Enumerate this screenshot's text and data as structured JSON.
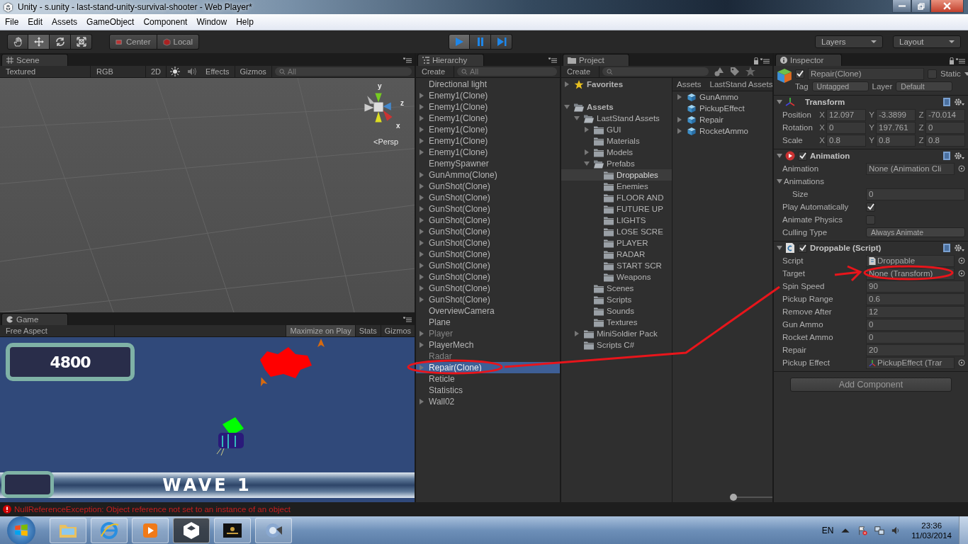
{
  "window": {
    "title": "Unity - s.unity - last-stand-unity-survival-shooter - Web Player*"
  },
  "menu": [
    "File",
    "Edit",
    "Assets",
    "GameObject",
    "Component",
    "Window",
    "Help"
  ],
  "toolbar": {
    "tools": [
      {
        "kind": "hand",
        "selected": false
      },
      {
        "kind": "move",
        "selected": true
      },
      {
        "kind": "rotate",
        "selected": false
      },
      {
        "kind": "scale",
        "selected": false
      }
    ],
    "pivot": [
      {
        "kind": "pivot",
        "label": "Center"
      },
      {
        "kind": "local",
        "label": "Local"
      }
    ],
    "playback": [
      {
        "kind": "play",
        "selected": true
      },
      {
        "kind": "pause",
        "selected": false
      },
      {
        "kind": "step",
        "selected": false
      }
    ],
    "layers": "Layers",
    "layout": "Layout"
  },
  "scene": {
    "tab": "Scene",
    "shading": "Textured",
    "render": "RGB",
    "mode_2d": "2D",
    "effects": "Effects",
    "gizmos": "Gizmos",
    "search_placeholder": "All",
    "axes": [
      "y",
      "z",
      "x"
    ],
    "projection": "<Persp"
  },
  "game": {
    "tab": "Game",
    "aspect": "Free Aspect",
    "buttons": [
      {
        "label": "Maximize on Play",
        "selected": true
      },
      {
        "label": "Stats",
        "selected": false
      },
      {
        "label": "Gizmos",
        "selected": false
      }
    ],
    "score": "4800",
    "wave": "WAVE 1"
  },
  "hierarchy": {
    "tab": "Hierarchy",
    "create": "Create",
    "search_placeholder": "All",
    "items": [
      {
        "label": "Directional light",
        "expandable": false,
        "disabled": false,
        "selected": false
      },
      {
        "label": "Enemy1(Clone)",
        "expandable": true,
        "disabled": false,
        "selected": false
      },
      {
        "label": "Enemy1(Clone)",
        "expandable": true,
        "disabled": false,
        "selected": false
      },
      {
        "label": "Enemy1(Clone)",
        "expandable": true,
        "disabled": false,
        "selected": false
      },
      {
        "label": "Enemy1(Clone)",
        "expandable": true,
        "disabled": false,
        "selected": false
      },
      {
        "label": "Enemy1(Clone)",
        "expandable": true,
        "disabled": false,
        "selected": false
      },
      {
        "label": "Enemy1(Clone)",
        "expandable": true,
        "disabled": false,
        "selected": false
      },
      {
        "label": "EnemySpawner",
        "expandable": false,
        "disabled": false,
        "selected": false
      },
      {
        "label": "GunAmmo(Clone)",
        "expandable": true,
        "disabled": false,
        "selected": false
      },
      {
        "label": "GunShot(Clone)",
        "expandable": true,
        "disabled": false,
        "selected": false
      },
      {
        "label": "GunShot(Clone)",
        "expandable": true,
        "disabled": false,
        "selected": false
      },
      {
        "label": "GunShot(Clone)",
        "expandable": true,
        "disabled": false,
        "selected": false
      },
      {
        "label": "GunShot(Clone)",
        "expandable": true,
        "disabled": false,
        "selected": false
      },
      {
        "label": "GunShot(Clone)",
        "expandable": true,
        "disabled": false,
        "selected": false
      },
      {
        "label": "GunShot(Clone)",
        "expandable": true,
        "disabled": false,
        "selected": false
      },
      {
        "label": "GunShot(Clone)",
        "expandable": true,
        "disabled": false,
        "selected": false
      },
      {
        "label": "GunShot(Clone)",
        "expandable": true,
        "disabled": false,
        "selected": false
      },
      {
        "label": "GunShot(Clone)",
        "expandable": true,
        "disabled": false,
        "selected": false
      },
      {
        "label": "GunShot(Clone)",
        "expandable": true,
        "disabled": false,
        "selected": false
      },
      {
        "label": "GunShot(Clone)",
        "expandable": true,
        "disabled": false,
        "selected": false
      },
      {
        "label": "OverviewCamera",
        "expandable": false,
        "disabled": false,
        "selected": false
      },
      {
        "label": "Plane",
        "expandable": false,
        "disabled": false,
        "selected": false
      },
      {
        "label": "Player",
        "expandable": true,
        "disabled": true,
        "selected": false
      },
      {
        "label": "PlayerMech",
        "expandable": true,
        "disabled": false,
        "selected": false
      },
      {
        "label": "Radar",
        "expandable": false,
        "disabled": true,
        "selected": false
      },
      {
        "label": "Repair(Clone)",
        "expandable": true,
        "disabled": false,
        "selected": true
      },
      {
        "label": "Reticle",
        "expandable": false,
        "disabled": false,
        "selected": false
      },
      {
        "label": "Statistics",
        "expandable": false,
        "disabled": false,
        "selected": false
      },
      {
        "label": "Wall02",
        "expandable": true,
        "disabled": false,
        "selected": false
      }
    ]
  },
  "project": {
    "tab": "Project",
    "create": "Create",
    "tree": [
      {
        "label": "Favorites",
        "kind": "favorites",
        "expandable": true,
        "expanded": false,
        "selected": false
      },
      {
        "label": "Assets",
        "kind": "root",
        "expandable": true,
        "expanded": true,
        "selected": false,
        "children": [
          {
            "label": "LastStand Assets",
            "kind": "folder",
            "expandable": true,
            "expanded": true,
            "selected": false,
            "children": [
              {
                "label": "GUI",
                "kind": "folder",
                "expandable": true,
                "expanded": false,
                "selected": false
              },
              {
                "label": "Materials",
                "kind": "folder",
                "expandable": false,
                "selected": false
              },
              {
                "label": "Models",
                "kind": "folder",
                "expandable": true,
                "expanded": false,
                "selected": false
              },
              {
                "label": "Prefabs",
                "kind": "folder",
                "expandable": true,
                "expanded": true,
                "selected": false,
                "children": [
                  {
                    "label": "Droppables",
                    "kind": "folder",
                    "expandable": false,
                    "selected": true
                  },
                  {
                    "label": "Enemies",
                    "kind": "folder",
                    "expandable": false,
                    "selected": false
                  },
                  {
                    "label": "FLOOR AND",
                    "kind": "folder",
                    "expandable": false,
                    "selected": false
                  },
                  {
                    "label": "FUTURE UP",
                    "kind": "folder",
                    "expandable": false,
                    "selected": false
                  },
                  {
                    "label": "LIGHTS",
                    "kind": "folder",
                    "expandable": false,
                    "selected": false
                  },
                  {
                    "label": "LOSE SCRE",
                    "kind": "folder",
                    "expandable": false,
                    "selected": false
                  },
                  {
                    "label": "PLAYER",
                    "kind": "folder",
                    "expandable": false,
                    "selected": false
                  },
                  {
                    "label": "RADAR",
                    "kind": "folder",
                    "expandable": false,
                    "selected": false
                  },
                  {
                    "label": "START SCR",
                    "kind": "folder",
                    "expandable": false,
                    "selected": false
                  },
                  {
                    "label": "Weapons",
                    "kind": "folder",
                    "expandable": false,
                    "selected": false
                  }
                ]
              },
              {
                "label": "Scenes",
                "kind": "folder",
                "expandable": false,
                "selected": false
              },
              {
                "label": "Scripts",
                "kind": "folder",
                "expandable": false,
                "selected": false
              },
              {
                "label": "Sounds",
                "kind": "folder",
                "expandable": false,
                "selected": false
              },
              {
                "label": "Textures",
                "kind": "folder",
                "expandable": false,
                "selected": false
              }
            ]
          },
          {
            "label": "MiniSoldier Pack",
            "kind": "folder",
            "expandable": true,
            "expanded": false,
            "selected": false
          },
          {
            "label": "Scripts C#",
            "kind": "folder",
            "expandable": false,
            "selected": false
          }
        ]
      }
    ],
    "breadcrumb": [
      "Assets",
      "LastStand Assets"
    ],
    "items": [
      {
        "label": "GunAmmo",
        "expandable": true
      },
      {
        "label": "PickupEffect",
        "expandable": false
      },
      {
        "label": "Repair",
        "expandable": true
      },
      {
        "label": "RocketAmmo",
        "expandable": true
      }
    ],
    "icon_size": {
      "level": 0
    }
  },
  "inspector": {
    "tab": "Inspector",
    "object": {
      "name": "Repair(Clone)",
      "active": true,
      "static_label": "Static",
      "static": false,
      "tag_label": "Tag",
      "tag": "Untagged",
      "layer_label": "Layer",
      "layer": "Default"
    },
    "components": [
      {
        "title": "Transform",
        "kind": "transform",
        "rows": [
          {
            "kind": "vector3",
            "label": "Position",
            "values": [
              {
                "axis": "X",
                "value": "12.097"
              },
              {
                "axis": "Y",
                "value": "-3.3899"
              },
              {
                "axis": "Z",
                "value": "-70.014"
              }
            ]
          },
          {
            "kind": "vector3",
            "label": "Rotation",
            "values": [
              {
                "axis": "X",
                "value": "0"
              },
              {
                "axis": "Y",
                "value": "197.761"
              },
              {
                "axis": "Z",
                "value": "0"
              }
            ]
          },
          {
            "kind": "vector3",
            "label": "Scale",
            "values": [
              {
                "axis": "X",
                "value": "0.8"
              },
              {
                "axis": "Y",
                "value": "0.8"
              },
              {
                "axis": "Z",
                "value": "0.8"
              }
            ]
          }
        ]
      },
      {
        "title": "Animation",
        "kind": "animation",
        "enabled": true,
        "rows": [
          {
            "kind": "object",
            "label": "Animation",
            "value": "None (Animation Cli"
          },
          {
            "kind": "foldout",
            "label": "Animations",
            "expanded": true,
            "children": [
              {
                "kind": "number",
                "label": "Size",
                "value": "0"
              }
            ]
          },
          {
            "kind": "checkbox",
            "label": "Play Automatically",
            "checked": true
          },
          {
            "kind": "checkbox",
            "label": "Animate Physics",
            "checked": false
          },
          {
            "kind": "dropdown",
            "label": "Culling Type",
            "value": "Always Animate"
          }
        ]
      },
      {
        "title": "Droppable (Script)",
        "kind": "script",
        "enabled": true,
        "rows": [
          {
            "kind": "script",
            "label": "Script",
            "value": "Droppable"
          },
          {
            "kind": "object",
            "label": "Target",
            "value": "None (Transform)"
          },
          {
            "kind": "number",
            "label": "Spin Speed",
            "value": "90"
          },
          {
            "kind": "number",
            "label": "Pickup Range",
            "value": "0.6"
          },
          {
            "kind": "number",
            "label": "Remove After",
            "value": "12"
          },
          {
            "kind": "number",
            "label": "Gun Ammo",
            "value": "0"
          },
          {
            "kind": "number",
            "label": "Rocket Ammo",
            "value": "0"
          },
          {
            "kind": "number",
            "label": "Repair",
            "value": "20"
          },
          {
            "kind": "reference",
            "label": "Pickup Effect",
            "value": "PickupEffect (Trar"
          }
        ]
      }
    ],
    "add_component": "Add Component"
  },
  "console": {
    "kind": "error",
    "message": "NullReferenceException: Object reference not set to an instance of an object"
  },
  "taskbar": {
    "apps": [
      {
        "kind": "explorer",
        "selected": false
      },
      {
        "kind": "browser",
        "selected": false
      },
      {
        "kind": "media",
        "selected": false
      },
      {
        "kind": "unity",
        "selected": true
      },
      {
        "kind": "thumbnail",
        "selected": false
      },
      {
        "kind": "remote",
        "selected": false
      }
    ],
    "language": "EN",
    "time": "23:36",
    "date": "11/03/2014"
  }
}
